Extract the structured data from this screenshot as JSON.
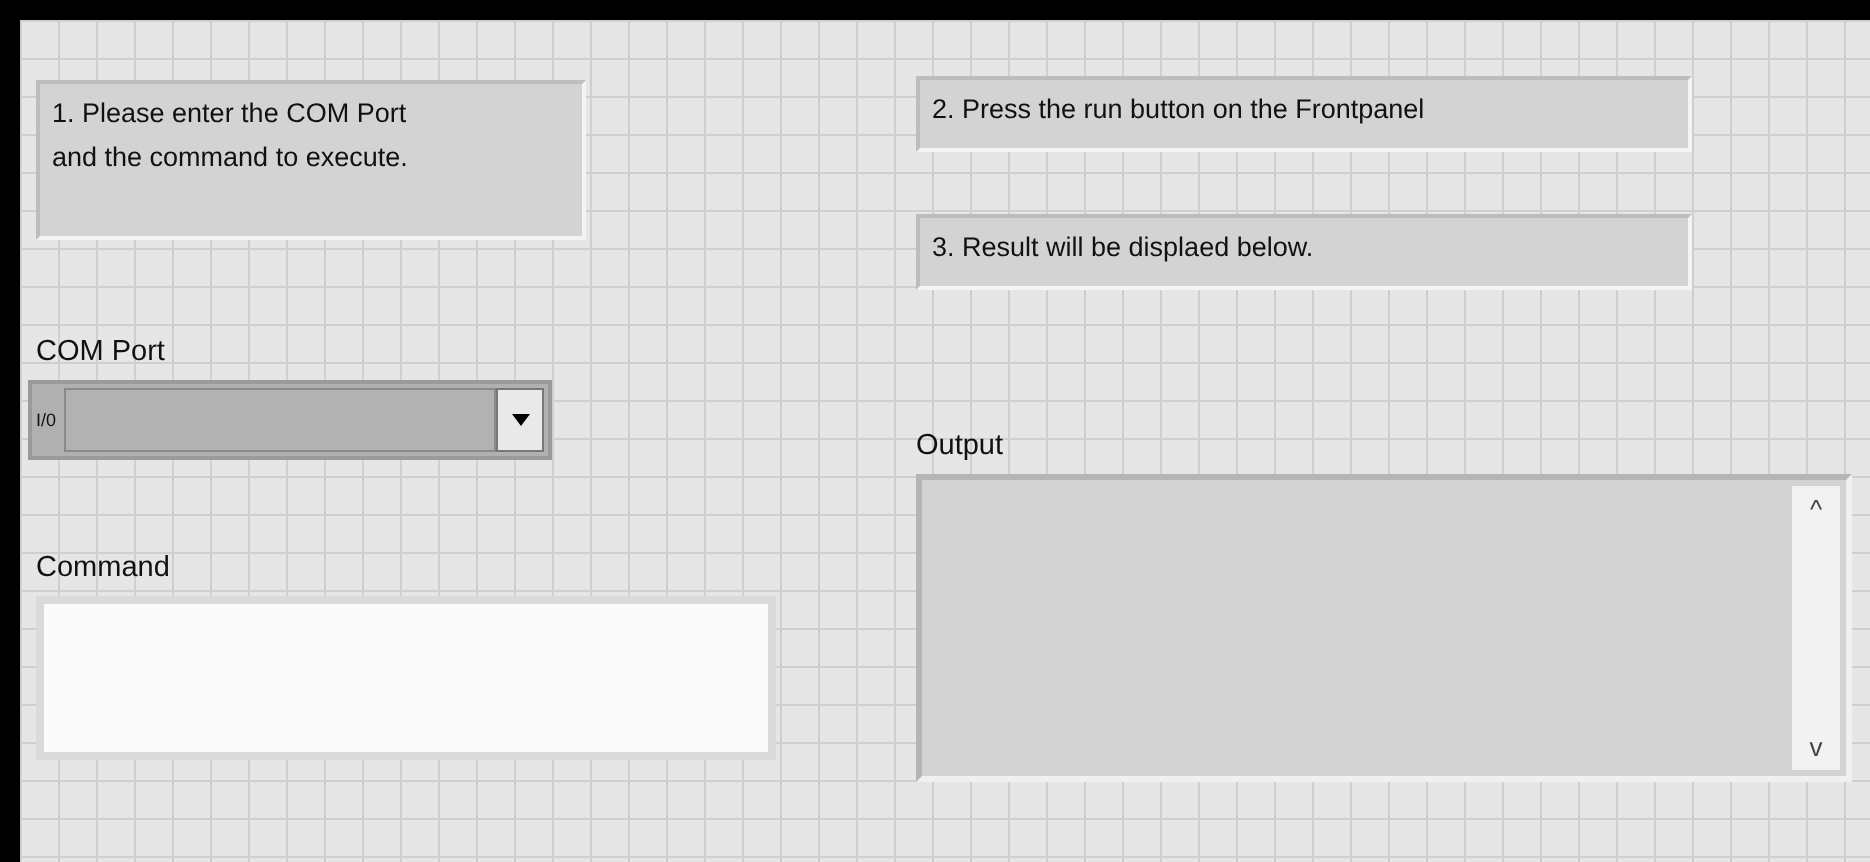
{
  "notes_left": [
    "1. Please enter the COM Port and the command to execute."
  ],
  "notes_right": [
    "2. Press the run button on the Frontpanel",
    "3. Result will be displaed below."
  ],
  "com_port": {
    "label": "COM Port",
    "io_symbol": "I/0"
  },
  "command": {
    "label": "Command"
  },
  "output": {
    "label": "Output",
    "scroll_up": "^",
    "scroll_down": "v"
  }
}
